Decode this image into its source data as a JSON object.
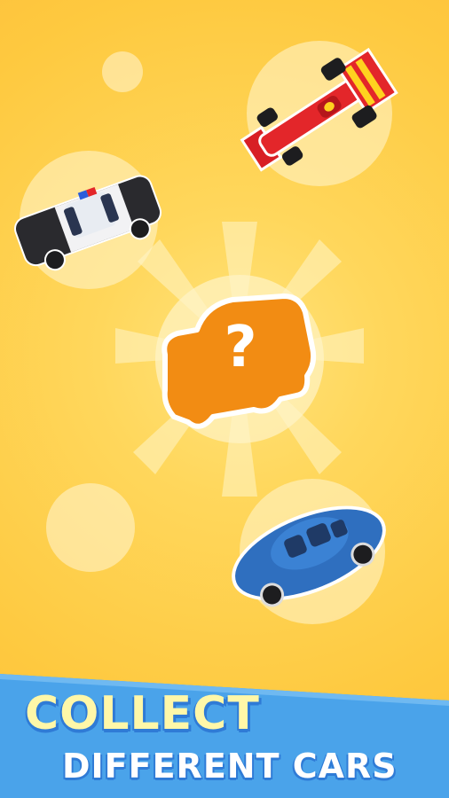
{
  "banner": {
    "line1": "COLLECT",
    "line2": "DIFFERENT CARS"
  },
  "mystery_car": {
    "symbol": "?"
  },
  "cars": [
    {
      "name": "race-car",
      "color": "#e3262a"
    },
    {
      "name": "police-car",
      "color": "#2a2a2e"
    },
    {
      "name": "beetle-car",
      "color": "#2f6fbf"
    }
  ],
  "colors": {
    "background": "#fec93f",
    "banner": "#4aa3ea",
    "mystery": "#f28c13"
  }
}
